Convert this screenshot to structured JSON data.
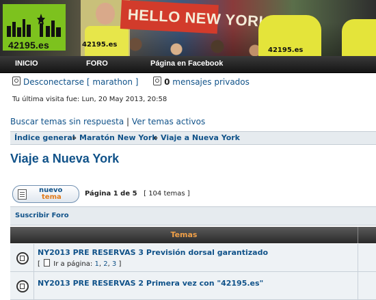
{
  "banner": {
    "logo_text": "42195.es",
    "sign_text": "HELLO NEW YORK",
    "shirt_text": "42195.es"
  },
  "nav": {
    "items": [
      "INICIO",
      "FORO",
      "Página en Facebook"
    ]
  },
  "user": {
    "logout": "Desconectarse [ marathon ]",
    "pm_count": "0",
    "pm_label": "mensajes privados",
    "last_visit": "Tu última visita fue: Lun, 20 May 2013, 20:58"
  },
  "quicklinks": {
    "unanswered": "Buscar temas sin respuesta",
    "separator": "|",
    "active": "Ver temas activos"
  },
  "breadcrumb": {
    "items": [
      "Índice general",
      "Maratón New York",
      "Viaje a Nueva York"
    ],
    "sep": "»"
  },
  "forum": {
    "title": "Viaje a Nueva York",
    "new_topic_line1": "nuevo",
    "new_topic_line2": "tema",
    "page_label": "Página 1 de 5",
    "topic_count": "[ 104 temas ]",
    "subscribe": "Suscribir Foro"
  },
  "table": {
    "header": "Temas",
    "rows": [
      {
        "title": "NY2013 PRE RESERVAS 3 Previsión dorsal garantizado",
        "pages_prefix": "[",
        "pages_label": "Ir a página:",
        "pages": [
          "1",
          "2",
          "3"
        ],
        "pages_suffix": "]"
      },
      {
        "title": "NY2013 PRE RESERVAS 2 Primera vez con \"42195.es\""
      }
    ]
  }
}
